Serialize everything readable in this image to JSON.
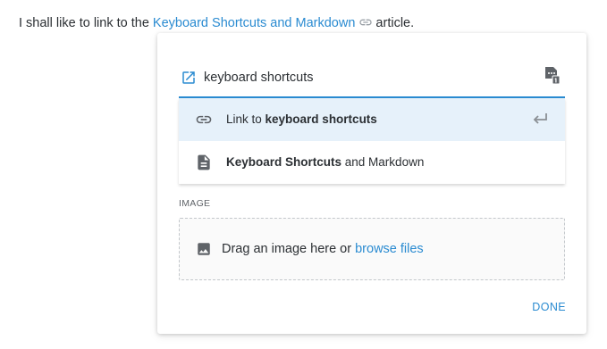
{
  "sentence": {
    "before": "I shall like to link to the ",
    "link_text": "Keyboard Shortcuts and Markdown",
    "after": "article."
  },
  "popup": {
    "search": {
      "value": "keyboard shortcuts",
      "placeholder": ""
    },
    "suggestions": [
      {
        "icon": "link-icon",
        "prefix": "Link to ",
        "bold": "keyboard shortcuts",
        "suffix": "",
        "selected": true,
        "action_icon": "enter-key-icon"
      },
      {
        "icon": "document-icon",
        "prefix": "",
        "bold": "Keyboard Shortcuts",
        "suffix": " and Markdown",
        "selected": false
      }
    ],
    "image_section": {
      "label": "IMAGE",
      "drop_text": "Drag an image here or ",
      "browse_text": "browse files"
    },
    "done_label": "DONE"
  },
  "colors": {
    "accent": "#2a8bd1",
    "selected_bg": "#e6f1fa",
    "text": "#2b2f33",
    "icon": "#5f6368"
  }
}
